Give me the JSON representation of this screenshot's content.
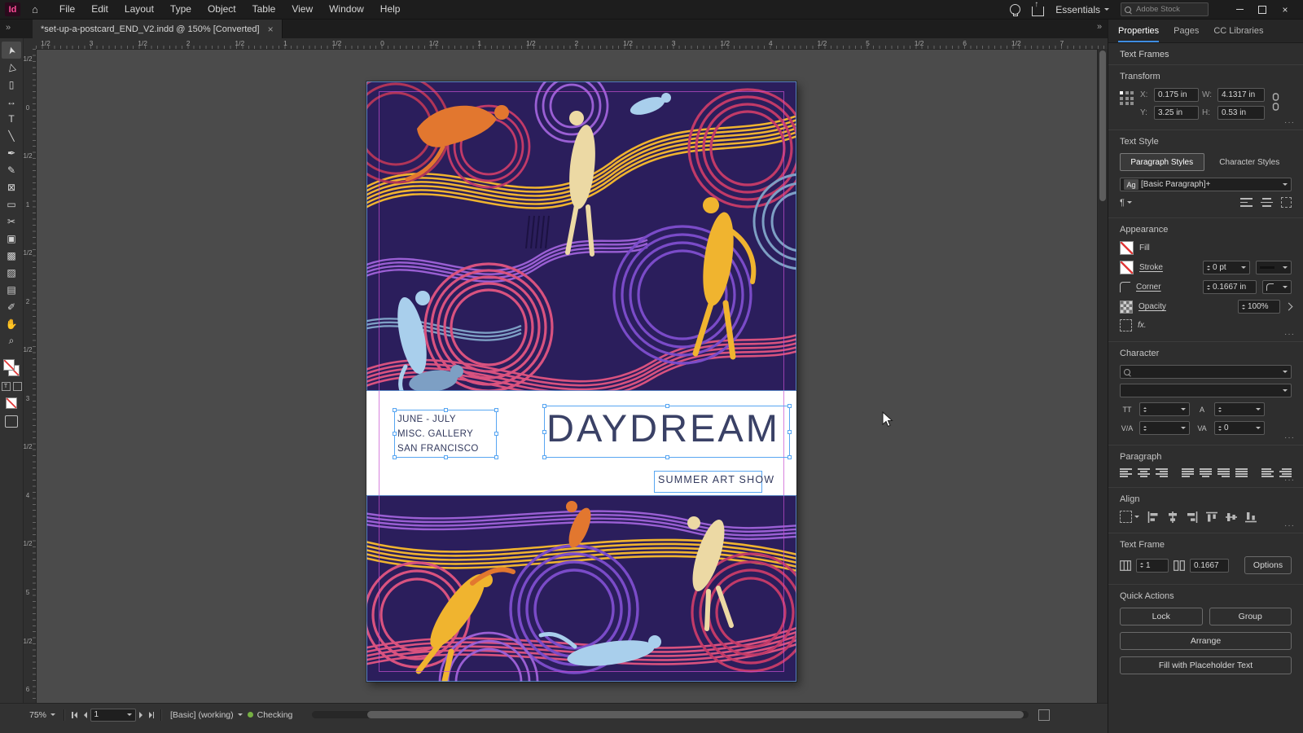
{
  "app": {
    "logo_text": "Id",
    "home_glyph": "⌂",
    "menus": [
      "File",
      "Edit",
      "Layout",
      "Type",
      "Object",
      "Table",
      "View",
      "Window",
      "Help"
    ],
    "workspace_label": "Essentials",
    "stock_search_placeholder": "Adobe Stock",
    "panel_collapse_glyph": "»",
    "close_glyph": "×"
  },
  "colors": {
    "accent_blue": "#3f8ce0",
    "selection_blue": "#58a6f2",
    "preflight_green": "#76b043",
    "logo_pink": "#ff4c98"
  },
  "document_tab": {
    "title": "*set-up-a-postcard_END_V2.indd @ 150% [Converted]",
    "close_glyph": "×"
  },
  "toolbar": {
    "tools": [
      {
        "name": "selection",
        "glyph": "➤"
      },
      {
        "name": "direct-selection",
        "glyph": "▷"
      },
      {
        "name": "page",
        "glyph": "▯"
      },
      {
        "name": "gap",
        "glyph": "↔"
      },
      {
        "name": "type",
        "glyph": "T"
      },
      {
        "name": "line",
        "glyph": "╲"
      },
      {
        "name": "pen",
        "glyph": "✒"
      },
      {
        "name": "pencil",
        "glyph": "✎"
      },
      {
        "name": "rectangle-frame",
        "glyph": "⊠"
      },
      {
        "name": "rectangle",
        "glyph": "▭"
      },
      {
        "name": "scissors",
        "glyph": "✂"
      },
      {
        "name": "free-transform",
        "glyph": "▣"
      },
      {
        "name": "gradient-swatch",
        "glyph": "▩"
      },
      {
        "name": "gradient-feather",
        "glyph": "▨"
      },
      {
        "name": "note",
        "glyph": "▤"
      },
      {
        "name": "eyedropper",
        "glyph": "✐"
      },
      {
        "name": "hand",
        "glyph": "✋"
      },
      {
        "name": "zoom",
        "glyph": "⌕"
      }
    ],
    "formatting_text_glyph": "T"
  },
  "rulers": {
    "horizontal_labels": [
      "1/2",
      "3",
      "1/2",
      "2",
      "1/2",
      "1",
      "1/2",
      "0",
      "1/2",
      "1",
      "1/2",
      "2",
      "1/2",
      "3",
      "1/2",
      "4",
      "1/2",
      "5",
      "1/2",
      "6",
      "1/2",
      "7"
    ],
    "vertical_labels": [
      "1/2",
      "0",
      "1/2",
      "1",
      "1/2",
      "2",
      "1/2",
      "3",
      "1/2",
      "4",
      "1/2",
      "5",
      "1/2",
      "6"
    ]
  },
  "canvas": {
    "texts": {
      "details_lines": [
        "JUNE - JULY",
        "MISC. GALLERY",
        "SAN FRANCISCO"
      ],
      "title": "DAYDREAM",
      "subtitle": "SUMMER ART SHOW"
    },
    "artwork": {
      "palette": {
        "background": "#2b1e5c",
        "band": "#ffffff",
        "pink": "#d9527f",
        "magenta": "#c13a68",
        "purple": "#7a4bc8",
        "violet": "#9a5fd4",
        "yellow": "#f0b42f",
        "orange": "#e2772f",
        "blue": "#a9cfec",
        "steel": "#7d9fc4",
        "tan": "#ecd9a4",
        "crimson": "#b03558",
        "hatch": "#1c1242",
        "guide_magenta": "#c84fd0",
        "frame_edge_blue": "#6aa9e8"
      }
    }
  },
  "properties_panel": {
    "tabs": [
      "Properties",
      "Pages",
      "CC Libraries"
    ],
    "selection_type": "Text Frames",
    "more_glyph": "···",
    "transform": {
      "title": "Transform",
      "x_label": "X:",
      "x_value": "0.175 in",
      "y_label": "Y:",
      "y_value": "3.25 in",
      "w_label": "W:",
      "w_value": "4.1317 in",
      "h_label": "H:",
      "h_value": "0.53 in"
    },
    "text_style": {
      "title": "Text Style",
      "paragraph_tab": "Paragraph Styles",
      "character_tab": "Character Styles",
      "style_sample": "Ag",
      "style_name": "[Basic Paragraph]+",
      "pilcrow_glyph": "¶"
    },
    "appearance": {
      "title": "Appearance",
      "fill_label": "Fill",
      "stroke_label": "Stroke",
      "stroke_weight": "0 pt",
      "corner_label": "Corner",
      "corner_value": "0.1667 in",
      "opacity_label": "Opacity",
      "opacity_value": "100%",
      "fx_label": "fx."
    },
    "character": {
      "title": "Character",
      "font_family_value": "",
      "font_style_value": "",
      "size_icon": "TT",
      "size_value": "",
      "leading_icon": "A",
      "leading_value": "",
      "kerning_icon": "V/A",
      "kerning_value": "",
      "tracking_icon": "VA",
      "tracking_value": "0"
    },
    "paragraph": {
      "title": "Paragraph"
    },
    "align": {
      "title": "Align"
    },
    "text_frame": {
      "title": "Text Frame",
      "columns_value": "1",
      "inset_value": "0.1667",
      "options_label": "Options"
    },
    "quick_actions": {
      "title": "Quick Actions",
      "lock_label": "Lock",
      "group_label": "Group",
      "arrange_label": "Arrange",
      "fill_placeholder_label": "Fill with Placeholder Text"
    }
  },
  "status_bar": {
    "zoom_value": "75%",
    "page_value": "1",
    "preflight_profile": "[Basic] (working)",
    "preflight_status": "Checking"
  }
}
